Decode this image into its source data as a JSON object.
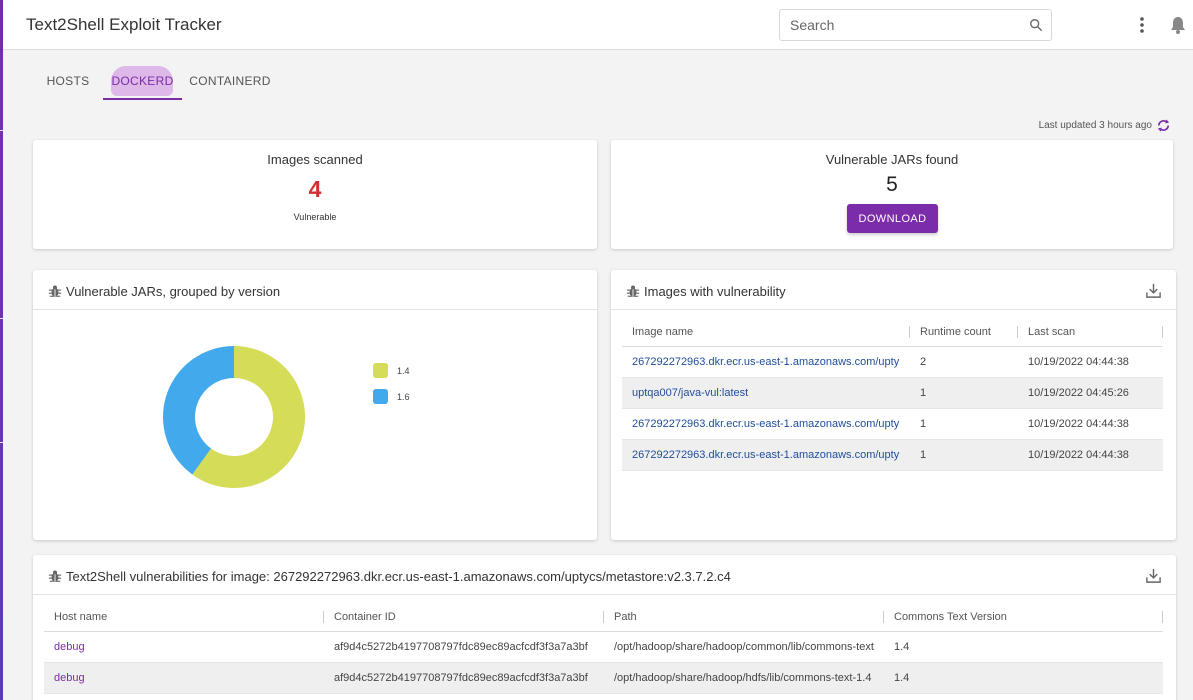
{
  "header": {
    "title": "Text2Shell Exploit Tracker",
    "search_placeholder": "Search"
  },
  "tabs": [
    {
      "label": "HOSTS",
      "active": false
    },
    {
      "label": "DOCKERD",
      "active": true
    },
    {
      "label": "CONTAINERD",
      "active": false
    }
  ],
  "last_updated": "Last updated 3 hours ago",
  "stats": {
    "images": {
      "title": "Images scanned",
      "value": "4",
      "sub": "Vulnerable"
    },
    "jars": {
      "title": "Vulnerable JARs found",
      "value": "5",
      "button": "DOWNLOAD"
    }
  },
  "jars_card": {
    "title": "Vulnerable JARs, grouped by version"
  },
  "chart_data": {
    "type": "pie",
    "donut": true,
    "categories": [
      "1.4",
      "1.6"
    ],
    "values": [
      3,
      2
    ],
    "colors": [
      "#d4dc58",
      "#41a9ec"
    ],
    "legend_position": "right"
  },
  "images_card": {
    "title": "Images with vulnerability",
    "columns": [
      "Image name",
      "Runtime count",
      "Last scan"
    ],
    "rows": [
      {
        "image": "267292272963.dkr.ecr.us-east-1.amazonaws.com/upty",
        "count": "2",
        "last_scan": "10/19/2022 04:44:38"
      },
      {
        "image": "uptqa007/java-vul:latest",
        "count": "1",
        "last_scan": "10/19/2022 04:45:26"
      },
      {
        "image": "267292272963.dkr.ecr.us-east-1.amazonaws.com/upty",
        "count": "1",
        "last_scan": "10/19/2022 04:44:38"
      },
      {
        "image": "267292272963.dkr.ecr.us-east-1.amazonaws.com/upty",
        "count": "1",
        "last_scan": "10/19/2022 04:44:38"
      }
    ]
  },
  "vuln_card": {
    "title": "Text2Shell vulnerabilities for image: 267292272963.dkr.ecr.us-east-1.amazonaws.com/uptycs/metastore:v2.3.7.2.c4",
    "columns": [
      "Host name",
      "Container ID",
      "Path",
      "Commons Text Version"
    ],
    "rows": [
      {
        "host": "debug",
        "container": "af9d4c5272b4197708797fdc89ec89acfcdf3f3a7a3bf",
        "path": "/opt/hadoop/share/hadoop/common/lib/commons-text",
        "version": "1.4"
      },
      {
        "host": "debug",
        "container": "af9d4c5272b4197708797fdc89ec89acfcdf3f3a7a3bf",
        "path": "/opt/hadoop/share/hadoop/hdfs/lib/commons-text-1.4",
        "version": "1.4"
      }
    ]
  },
  "colors": {
    "accent": "#7b2ca8",
    "danger": "#d32f2f",
    "link": "#1f4d9c"
  },
  "icons": [
    "search-icon",
    "kebab-menu-icon",
    "bell-icon",
    "refresh-icon",
    "bug-icon",
    "download-icon"
  ]
}
